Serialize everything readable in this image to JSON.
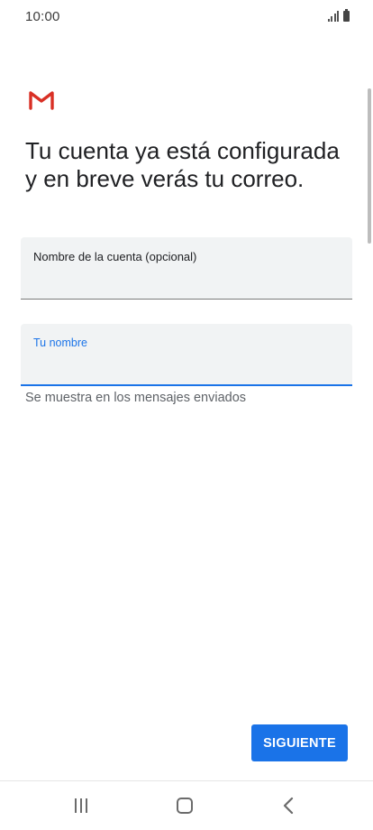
{
  "status_bar": {
    "time": "10:00"
  },
  "icons": {
    "app_logo": "gmail-logo-icon",
    "signal": "signal-icon",
    "battery": "battery-icon",
    "nav_recents": "recents-icon",
    "nav_home": "home-icon",
    "nav_back": "back-icon"
  },
  "colors": {
    "accent": "#1a73e8",
    "gmail_red": "#d93025",
    "field_background": "#f1f3f4"
  },
  "main": {
    "title": "Tu cuenta ya está configurada y en breve verás tu correo.",
    "account_field": {
      "label": "Nombre de la cuenta (opcional)",
      "value": ""
    },
    "name_field": {
      "label": "Tu nombre",
      "value": "",
      "helper": "Se muestra en los mensajes enviados"
    },
    "next_button_label": "SIGUIENTE"
  }
}
